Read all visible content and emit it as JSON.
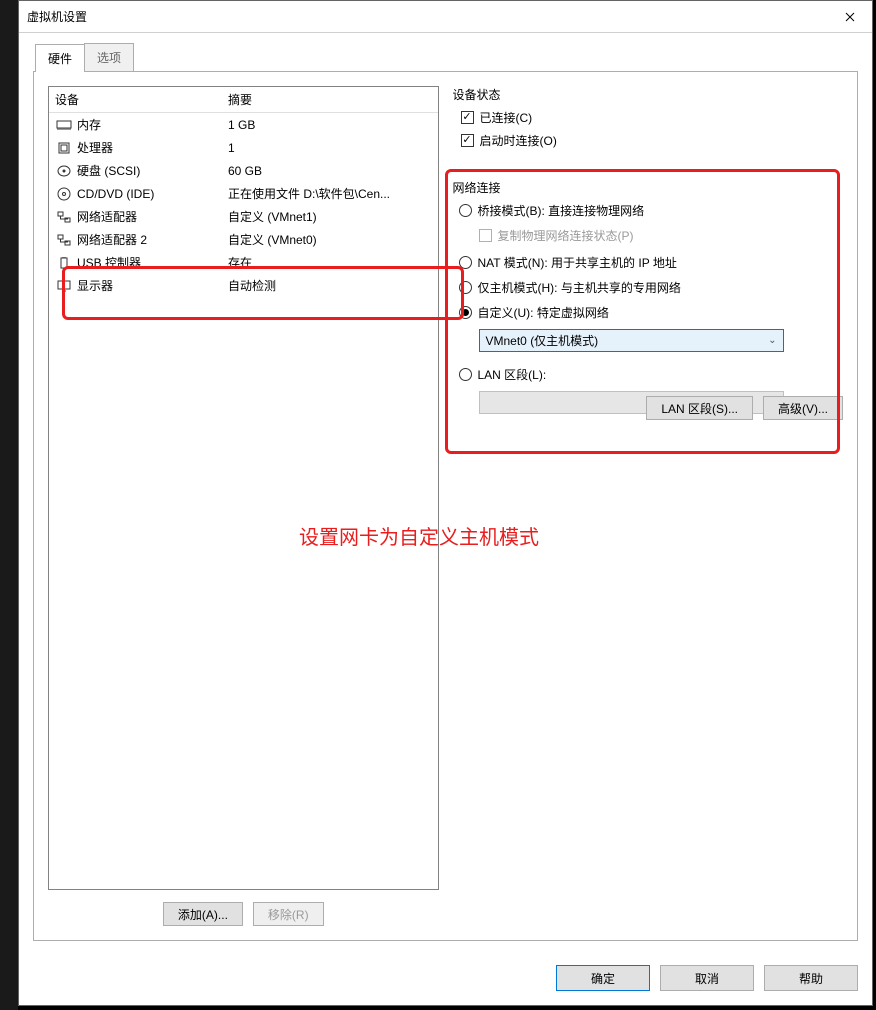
{
  "window": {
    "title": "虚拟机设置"
  },
  "tabs": {
    "hardware": "硬件",
    "options": "选项"
  },
  "deviceTable": {
    "col1": "设备",
    "col2": "摘要",
    "rows": [
      {
        "name": "内存",
        "summary": "1 GB",
        "icon": "memory"
      },
      {
        "name": "处理器",
        "summary": "1",
        "icon": "cpu"
      },
      {
        "name": "硬盘 (SCSI)",
        "summary": "60 GB",
        "icon": "disk"
      },
      {
        "name": "CD/DVD (IDE)",
        "summary": "正在使用文件 D:\\软件包\\Cen...",
        "icon": "cd"
      },
      {
        "name": "网络适配器",
        "summary": "自定义 (VMnet1)",
        "icon": "net"
      },
      {
        "name": "网络适配器 2",
        "summary": "自定义 (VMnet0)",
        "icon": "net"
      },
      {
        "name": "USB 控制器",
        "summary": "存在",
        "icon": "usb"
      },
      {
        "name": "显示器",
        "summary": "自动检测",
        "icon": "display"
      }
    ]
  },
  "addRemove": {
    "add": "添加(A)...",
    "remove": "移除(R)"
  },
  "deviceState": {
    "title": "设备状态",
    "connected": "已连接(C)",
    "connectAtPowerOn": "启动时连接(O)"
  },
  "network": {
    "title": "网络连接",
    "bridged": "桥接模式(B): 直接连接物理网络",
    "replicate": "复制物理网络连接状态(P)",
    "nat": "NAT 模式(N): 用于共享主机的 IP 地址",
    "hostOnly": "仅主机模式(H): 与主机共享的专用网络",
    "custom": "自定义(U): 特定虚拟网络",
    "customValue": "VMnet0 (仅主机模式)",
    "lanSegment": "LAN 区段(L):",
    "lanSegBtn": "LAN 区段(S)...",
    "advancedBtn": "高级(V)..."
  },
  "annotation": "设置网卡为自定义主机模式",
  "dialogButtons": {
    "ok": "确定",
    "cancel": "取消",
    "help": "帮助"
  }
}
